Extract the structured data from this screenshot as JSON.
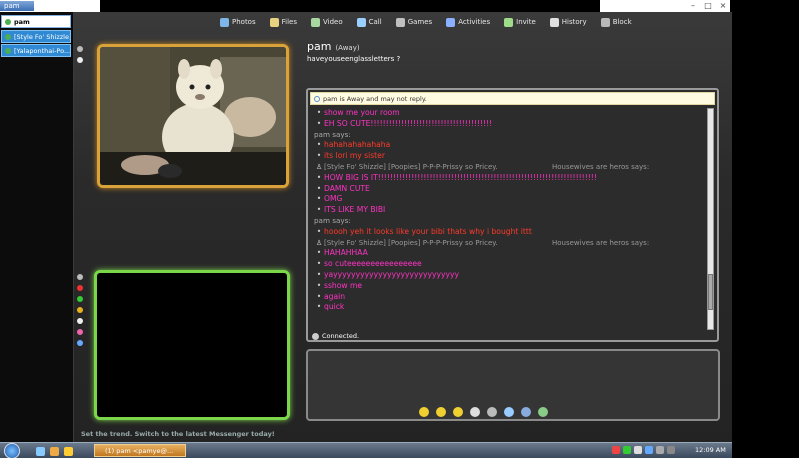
{
  "window": {
    "title": "pam",
    "tabs": [
      {
        "label": "pam",
        "active": true
      },
      {
        "label": "[Style Fo' Shizzle]...",
        "active": false
      },
      {
        "label": "[Yalaponthai-Po...",
        "active": false
      }
    ]
  },
  "toolbar": {
    "items": [
      {
        "label": "Photos",
        "icon": "photos-icon",
        "color": "#7fb6e8"
      },
      {
        "label": "Files",
        "icon": "files-icon",
        "color": "#e8d27f"
      },
      {
        "label": "Video",
        "icon": "video-icon",
        "color": "#a8d8a0"
      },
      {
        "label": "Call",
        "icon": "call-icon",
        "color": "#9ad0ff"
      },
      {
        "label": "Games",
        "icon": "games-icon",
        "color": "#c0c0c0"
      },
      {
        "label": "Activities",
        "icon": "activities-icon",
        "color": "#8ab0ff"
      },
      {
        "label": "Invite",
        "icon": "invite-icon",
        "color": "#9fdc8a"
      },
      {
        "label": "History",
        "icon": "history-icon",
        "color": "#e0e0e0"
      },
      {
        "label": "Block",
        "icon": "block-icon",
        "color": "#b8b8b8"
      }
    ]
  },
  "contact": {
    "name": "pam",
    "status": "(Away)",
    "personal_message": "haveyouseenglassletters ?"
  },
  "history": {
    "info_bar": "pam is Away and may not reply.",
    "messages": [
      {
        "kind": "pink",
        "bullet": true,
        "text": "show me your room"
      },
      {
        "kind": "pink",
        "bullet": true,
        "text": "EH SO CUTE!!!!!!!!!!!!!!!!!!!!!!!!!!!!!!!!!!!!!!!!"
      },
      {
        "kind": "says",
        "text": "pam says:"
      },
      {
        "kind": "red",
        "bullet": true,
        "text": "hahahahahahaha"
      },
      {
        "kind": "red",
        "bullet": true,
        "text": "its lori my sister"
      },
      {
        "kind": "wink",
        "text": "[Style Fo' Shizzle] [Poopies] P-P-P-Prissy so Pricey.",
        "extra": "Housewives are heros says:"
      },
      {
        "kind": "pink",
        "bullet": true,
        "text": "HOW BIG IS IT!!!!!!!!!!!!!!!!!!!!!!!!!!!!!!!!!!!!!!!!!!!!!!!!!!!!!!!!!!!!!!!!!!!!!!!!"
      },
      {
        "kind": "pink",
        "bullet": true,
        "text": "DAMN CUTE"
      },
      {
        "kind": "pink",
        "bullet": true,
        "text": "OMG"
      },
      {
        "kind": "pink",
        "bullet": true,
        "text": "ITS LIKE MY BIBI"
      },
      {
        "kind": "says",
        "text": "pam says:"
      },
      {
        "kind": "red",
        "bullet": true,
        "text": "hoooh yeh it looks like your bibi thats why i bought ittt"
      },
      {
        "kind": "wink",
        "text": "[Style Fo' Shizzle] [Poopies] P-P-P-Prissy so Pricey.",
        "extra": "Housewives are heros says:"
      },
      {
        "kind": "pink",
        "bullet": true,
        "text": "HAHAHHAA"
      },
      {
        "kind": "pink",
        "bullet": true,
        "text": "so cuteeeeeeeeeeeeeeee"
      },
      {
        "kind": "pink",
        "bullet": true,
        "text": "yayyyyyyyyyyyyyyyyyyyyyyyyyyyy"
      },
      {
        "kind": "pink",
        "bullet": true,
        "text": "sshow me"
      },
      {
        "kind": "pink",
        "bullet": true,
        "text": "again"
      },
      {
        "kind": "pink",
        "bullet": true,
        "text": "quick"
      }
    ],
    "connection_status": "Connected."
  },
  "input": {
    "value": ""
  },
  "promo": "Set the trend. Switch to the latest Messenger today!",
  "taskbar": {
    "task_label": "(1) pam <pamye@...",
    "clock": "12:09 AM"
  }
}
